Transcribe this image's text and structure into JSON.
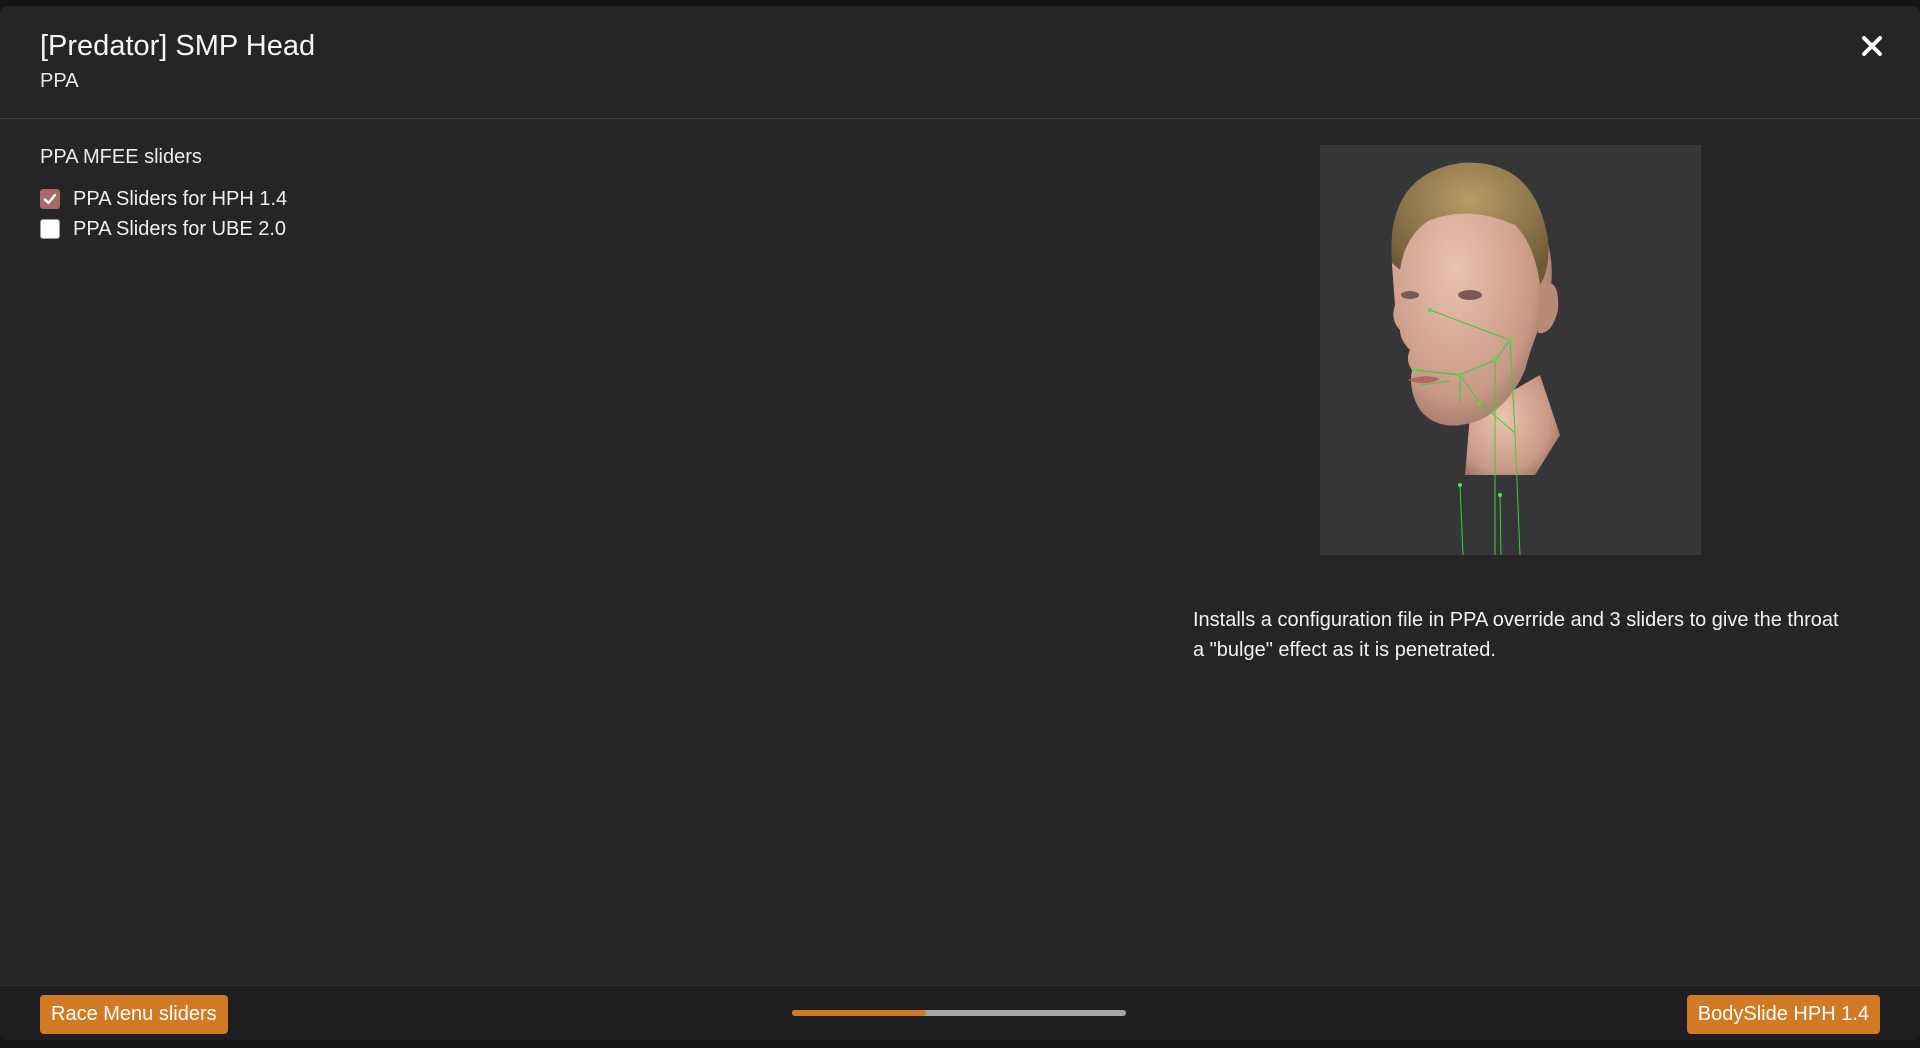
{
  "header": {
    "title": "[Predator] SMP Head",
    "subtitle": "PPA"
  },
  "group": {
    "title": "PPA MFEE sliders",
    "options": [
      {
        "label": "PPA Sliders for HPH 1.4",
        "checked": true
      },
      {
        "label": "PPA Sliders for UBE 2.0",
        "checked": false
      }
    ]
  },
  "preview": {
    "description": "Installs a configuration file in PPA override and 3 sliders to give the throat a \"bulge\" effect as it is penetrated."
  },
  "footer": {
    "back_label": "Race Menu sliders",
    "next_label": "BodySlide HPH 1.4",
    "progress_fraction": 0.4
  },
  "colors": {
    "accent": "#d17a24",
    "checkbox_checked": "#a36b63",
    "background": "#252527"
  },
  "icons": {
    "close": "close-icon",
    "check": "checkmark-icon"
  }
}
